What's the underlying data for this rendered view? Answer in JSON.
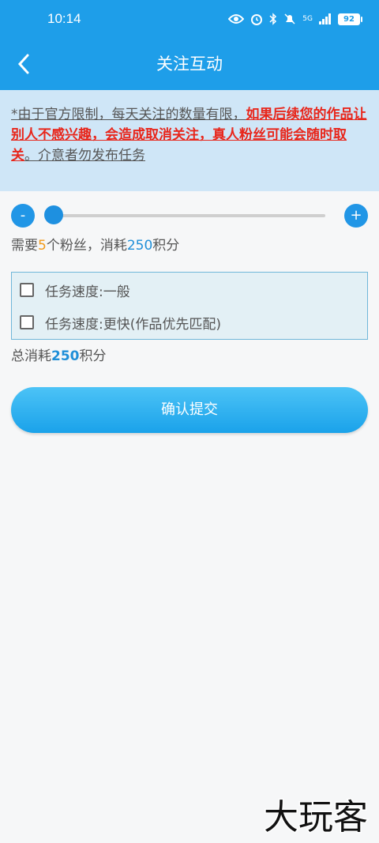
{
  "status_bar": {
    "time": "10:14",
    "battery": "92",
    "network": "5G"
  },
  "nav": {
    "title": "关注互动"
  },
  "notice": {
    "prefix": "*由于官方限制，每天关注的数量有限，",
    "warning": "如果后续您的作品让别人不感兴趣，会造成取消关注，真人粉丝可能会随时取关",
    "suffix": "。介意者勿发布任务"
  },
  "slider": {
    "minus_label": "-",
    "plus_label": "+"
  },
  "need": {
    "prefix": "需要",
    "count": "5",
    "middle": "个粉丝，消耗",
    "points": "250",
    "suffix": "积分"
  },
  "options": [
    {
      "label": "任务速度:一般",
      "checked": false
    },
    {
      "label": "任务速度:更快(作品优先匹配)",
      "checked": false
    }
  ],
  "total": {
    "prefix": "总消耗",
    "points": "250",
    "suffix": "积分"
  },
  "submit": {
    "label": "确认提交"
  },
  "watermark": {
    "text": "大玩客"
  },
  "colors": {
    "primary": "#1e9ee9",
    "notice_bg": "#cfe6f7",
    "warning_red": "#e8261b",
    "accent_orange": "#f29a18"
  }
}
